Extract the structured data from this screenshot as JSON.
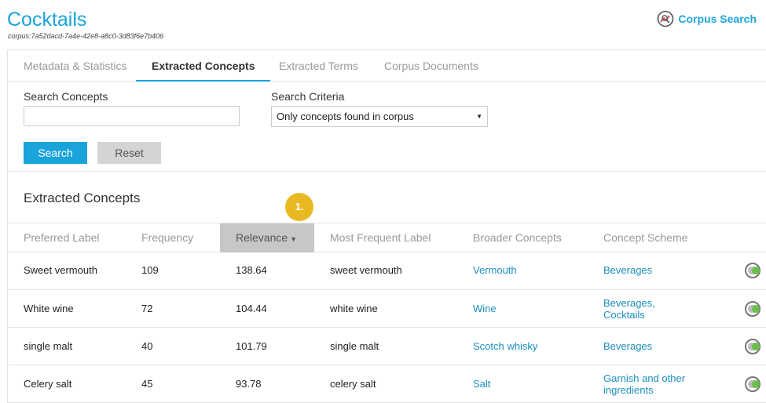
{
  "header": {
    "title": "Cocktails",
    "corpus_id": "corpus:7a52dacd-7a4e-42e8-a8c0-3d83f6e7b406",
    "corpus_search_label": "Corpus Search"
  },
  "tabs": [
    {
      "label": "Metadata & Statistics",
      "active": false
    },
    {
      "label": "Extracted Concepts",
      "active": true
    },
    {
      "label": "Extracted Terms",
      "active": false
    },
    {
      "label": "Corpus Documents",
      "active": false
    }
  ],
  "search": {
    "concepts_label": "Search Concepts",
    "concepts_value": "",
    "criteria_label": "Search Criteria",
    "criteria_value": "Only concepts found in corpus",
    "search_button": "Search",
    "reset_button": "Reset"
  },
  "section": {
    "title": "Extracted Concepts",
    "badge": "1."
  },
  "table": {
    "columns": [
      "Preferred Label",
      "Frequency",
      "Relevance",
      "Most Frequent Label",
      "Broader Concepts",
      "Concept Scheme"
    ],
    "sorted_column": "Relevance",
    "rows": [
      {
        "preferred": "Sweet vermouth",
        "frequency": "109",
        "relevance": "138.64",
        "most_frequent": "sweet vermouth",
        "broader": "Vermouth",
        "scheme_1": "Beverages",
        "scheme_2": ""
      },
      {
        "preferred": "White wine",
        "frequency": "72",
        "relevance": "104.44",
        "most_frequent": "white wine",
        "broader": "Wine",
        "scheme_1": "Beverages,",
        "scheme_2": "Cocktails"
      },
      {
        "preferred": "single malt",
        "frequency": "40",
        "relevance": "101.79",
        "most_frequent": "single malt",
        "broader": "Scotch whisky",
        "scheme_1": "Beverages",
        "scheme_2": ""
      },
      {
        "preferred": "Celery salt",
        "frequency": "45",
        "relevance": "93.78",
        "most_frequent": "celery salt",
        "broader": "Salt",
        "scheme_1": "Garnish and other",
        "scheme_2": "ingredients"
      }
    ]
  },
  "colors": {
    "accent": "#1ba4db",
    "link": "#1a8fbf",
    "badge": "#e8b923",
    "toggle_on": "#6abf4b"
  },
  "icons": {
    "corpus_search": "corpus-search-icon",
    "sort": "caret-down-icon",
    "select": "caret-down-icon",
    "toggle": "toggle-switch-icon"
  }
}
